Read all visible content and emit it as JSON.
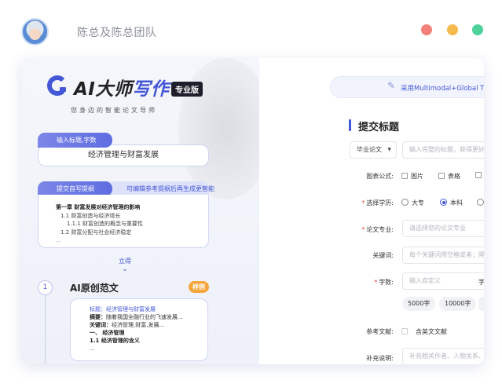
{
  "topbar": {
    "team_name": "陈总及陈总团队"
  },
  "left": {
    "logo": {
      "prefix": "AI大师",
      "accent": "写作",
      "badge": "专业版"
    },
    "slogan": "您身边的智能论文导师",
    "title_card": {
      "tag": "输入标题,字数",
      "value": "经济管理与财富发展"
    },
    "outline_card": {
      "tag": "提交自写提纲",
      "hint": "可编辑参考提纲后再生成更智能",
      "lines": [
        "第一章 财富发展对经济管理的影响",
        "1.1 财富创造与经济增长",
        "1.1.1 财富创造的概念与重要性",
        "1.2 财富分配与社会经济稳定",
        "..."
      ]
    },
    "generate": {
      "label": "立得",
      "chevron": "⌄"
    },
    "section": {
      "step": "1",
      "title": "AI原创范文",
      "badge": "样例",
      "sample": {
        "title_line": "标题：经济管理与财富发展",
        "abstract_key": "摘要：",
        "abstract_val": "随着我国全融行业的飞速发展...",
        "keywords_key": "关键词：",
        "keywords_val": "经济管理,财富,发展...",
        "h1": "一、 经济管理",
        "h2": "1.1 经济管理的含义",
        "more": "..."
      }
    }
  },
  "right": {
    "banner": "采用Multimodal+Global Th",
    "form_title": "提交标题",
    "paper_type": "毕业论文",
    "title_placeholder": "输入完整的标题，获得更好的",
    "chart_label": "图表公式:",
    "chart_options": [
      "图片",
      "表格"
    ],
    "degree_label": "选择学历:",
    "degree_options": [
      "大专",
      "本科"
    ],
    "degree_selected": "本科",
    "major_label": "论文专业:",
    "major_placeholder": "请选择您的论文专业",
    "keywords_label": "关键词:",
    "keywords_placeholder": "每个关键词用空格或者；隔开",
    "words_label": "字数:",
    "words_placeholder": "输入自定义",
    "words_unit": "字",
    "word_presets": [
      "5000字",
      "10000字"
    ],
    "refs_label": "参考文献:",
    "refs_option": "含英文文献",
    "extra_label": "补充说明:",
    "extra_placeholder": "补充相关作者、人物关系、作"
  }
}
